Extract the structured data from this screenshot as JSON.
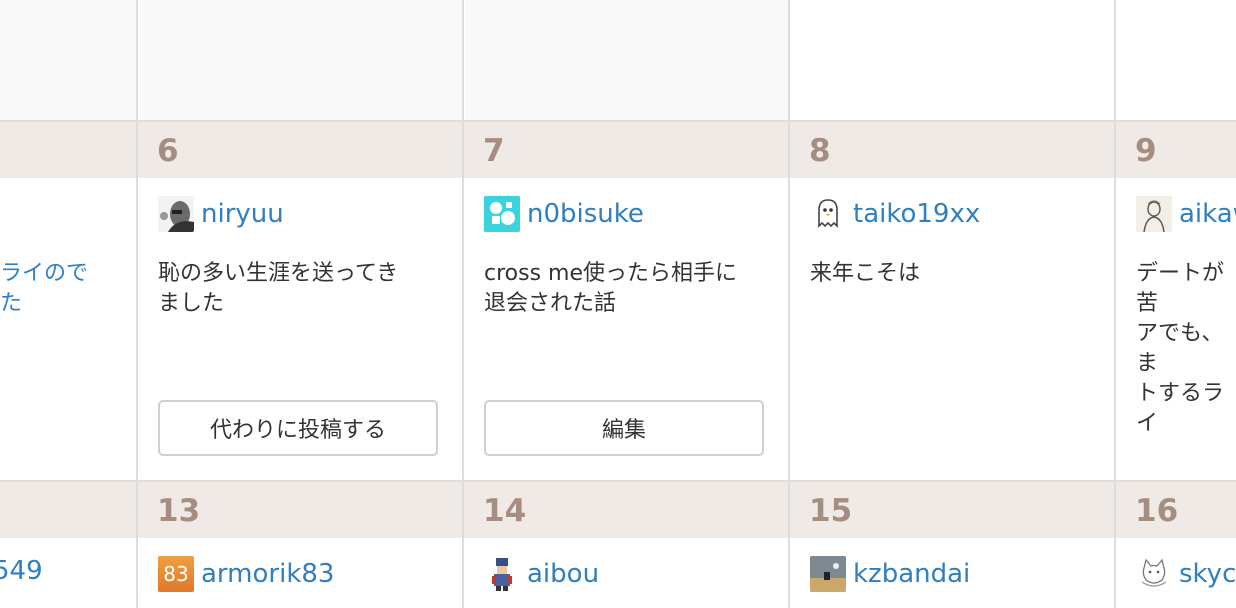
{
  "week1": {
    "partial_left_title": "ライので\nた",
    "days": [
      {
        "date": "6",
        "user": "niryuu",
        "title": "恥の多い生涯を送ってき\nました",
        "button": "代わりに投稿する"
      },
      {
        "date": "7",
        "user": "n0bisuke",
        "title": "cross me使ったら相手に\n退会された話",
        "button": "編集"
      },
      {
        "date": "8",
        "user": "taiko19xx",
        "title": "来年こそは"
      },
      {
        "date": "9",
        "user": "aikaw",
        "title": "デートが苦\nアでも、ま\nトするライ"
      }
    ]
  },
  "week2": {
    "partial_left_user": "549",
    "days": [
      {
        "date": "13",
        "user": "armorik83",
        "avatar_text": "83"
      },
      {
        "date": "14",
        "user": "aibou"
      },
      {
        "date": "15",
        "user": "kzbandai"
      },
      {
        "date": "16",
        "user": "skyc"
      }
    ]
  },
  "colors": {
    "link": "#2f7fc1",
    "day_number": "#a58d82",
    "day_header_bg": "#efeae6",
    "grid_line": "#dcdcdc"
  },
  "icons": {
    "niryuu": "face-photo-avatar",
    "n0bisuke": "cyan-puzzle-avatar",
    "taiko19xx": "ghost-avatar",
    "aikaw": "sketch-portrait-avatar",
    "armorik83": "orange-83-avatar",
    "aibou": "pixel-character-avatar",
    "kzbandai": "landscape-photo-avatar",
    "skyc": "cat-sketch-avatar"
  }
}
